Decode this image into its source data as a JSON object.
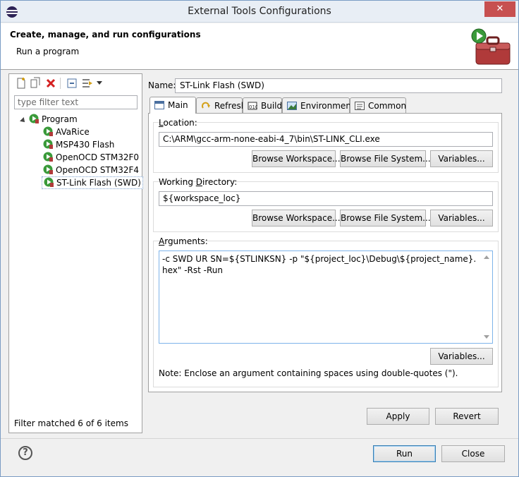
{
  "window": {
    "title": "External Tools Configurations",
    "close_glyph": "✕"
  },
  "banner": {
    "title": "Create, manage, and run configurations",
    "subtitle": "Run a program"
  },
  "left": {
    "filter_placeholder": "type filter text",
    "tree": {
      "root": "Program",
      "items": [
        "AVaRice",
        "MSP430 Flash",
        "OpenOCD STM32F0",
        "OpenOCD STM32F4",
        "ST-Link Flash (SWD)"
      ]
    },
    "status": "Filter matched 6 of 6 items"
  },
  "config": {
    "name_label": "Name:",
    "name_value": "ST-Link Flash (SWD)",
    "tabs": [
      "Main",
      "Refresh",
      "Build",
      "Environment",
      "Common"
    ],
    "location": {
      "label_pre": "",
      "label_mn": "L",
      "label_post": "ocation:",
      "value": "C:\\ARM\\gcc-arm-none-eabi-4_7\\bin\\ST-LINK_CLI.exe"
    },
    "workdir": {
      "label_pre": "Working ",
      "label_mn": "D",
      "label_post": "irectory:",
      "value": "${workspace_loc}"
    },
    "arguments": {
      "label_pre": "",
      "label_mn": "A",
      "label_post": "rguments:",
      "value": "-c SWD UR SN=${STLINKSN} -p \"${project_loc}\\Debug\\${project_name}.hex\" -Rst -Run"
    },
    "buttons": {
      "browse_workspace": "Browse Workspace...",
      "browse_fs": "Browse File System...",
      "variables": "Variables..."
    },
    "note": "Note: Enclose an argument containing spaces using double-quotes (\")."
  },
  "actions": {
    "apply": "Apply",
    "revert": "Revert",
    "run": "Run",
    "close": "Close",
    "help": "?"
  }
}
